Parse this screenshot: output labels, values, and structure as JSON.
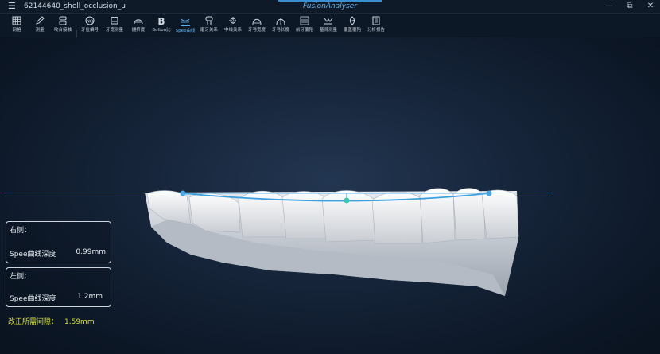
{
  "titlebar": {
    "file_name": "62144640_shell_occlusion_u",
    "brand": "FusionAnalyser",
    "minimize": "—",
    "restore": "⧉",
    "close": "✕"
  },
  "toolbar": {
    "items": [
      {
        "label": "网格",
        "icon": "grid-icon"
      },
      {
        "label": "测量",
        "icon": "pencil-icon"
      },
      {
        "label": "咬合接触",
        "icon": "occlusion-contact-icon"
      },
      {
        "label": "牙位编号",
        "icon": "tooth-number-icon"
      },
      {
        "label": "牙宽测量",
        "icon": "tooth-width-icon"
      },
      {
        "label": "拥挤度",
        "icon": "crowding-icon"
      },
      {
        "label": "Bolton比",
        "icon": "bolton-icon"
      },
      {
        "label": "Spee曲线",
        "icon": "spee-curve-icon"
      },
      {
        "label": "磨牙关系",
        "icon": "molar-relation-icon"
      },
      {
        "label": "中线关系",
        "icon": "midline-icon"
      },
      {
        "label": "牙弓宽度",
        "icon": "arch-width-icon"
      },
      {
        "label": "牙弓长度",
        "icon": "arch-length-icon"
      },
      {
        "label": "前牙覆殆",
        "icon": "overbite-icon"
      },
      {
        "label": "基骨测量",
        "icon": "basal-bone-icon"
      },
      {
        "label": "覆盖覆殆",
        "icon": "overjet-icon"
      },
      {
        "label": "分析报告",
        "icon": "report-icon"
      }
    ],
    "active": "Spee曲线"
  },
  "subbar": {
    "icons": [
      "view-front-icon",
      "view-arch-icon",
      "view-left-icon",
      "view-right-icon",
      "view-top-icon",
      "view-occlusal-icon",
      "view-bottom-icon"
    ]
  },
  "right_panel": {
    "title": "右侧：",
    "metric_label": "Spee曲线深度",
    "metric_value": "0.99mm"
  },
  "left_panel": {
    "title": "左侧：",
    "metric_label": "Spee曲线深度",
    "metric_value": "1.2mm"
  },
  "correction": {
    "label": "改正所需间隙：",
    "value": "1.59mm"
  },
  "colors": {
    "accent": "#5fb0f0",
    "curve": "#3aa0e0",
    "plane": "#4a9ad0",
    "highlight": "#d8e034"
  }
}
